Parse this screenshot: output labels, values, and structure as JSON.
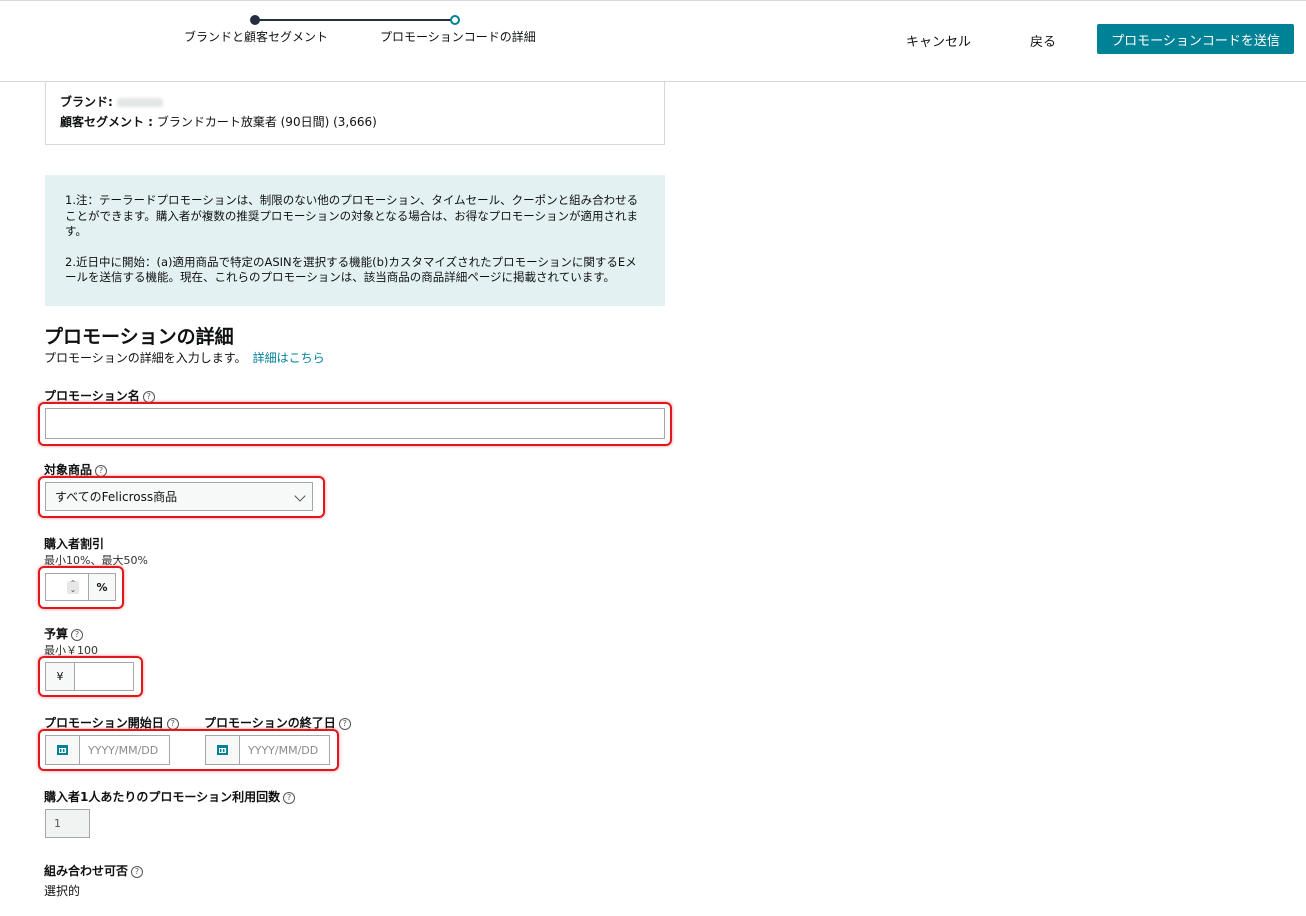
{
  "stepper": {
    "step1": "ブランドと顧客セグメント",
    "step2": "プロモーションコードの詳細"
  },
  "header_actions": {
    "cancel": "キャンセル",
    "back": "戻る",
    "submit": "プロモーションコードを送信"
  },
  "summary": {
    "brand_label": "ブランド:",
    "segment_label": "顧客セグメント :",
    "segment_value": "ブランドカート放棄者 (90日間) (3,666)"
  },
  "notice": {
    "p1": "1.注：テーラードプロモーションは、制限のない他のプロモーション、タイムセール、クーポンと組み合わせることができます。購入者が複数の推奨プロモーションの対象となる場合は、お得なプロモーションが適用されます。",
    "p2": "2.近日中に開始：(a)適用商品で特定のASINを選択する機能(b)カスタマイズされたプロモーションに関するEメールを送信する機能。現在、これらのプロモーションは、該当商品の商品詳細ページに掲載されています。"
  },
  "details": {
    "title": "プロモーションの詳細",
    "subtitle": "プロモーションの詳細を入力します。",
    "link": "詳細はこちら"
  },
  "form": {
    "promo_name_label": "プロモーション名",
    "promo_name_value": "",
    "products_label": "対象商品",
    "products_value": "すべてのFelicross商品",
    "discount_label": "購入者割引",
    "discount_hint": "最小10%、最大50%",
    "discount_unit": "%",
    "budget_label": "予算",
    "budget_hint": "最小￥100",
    "budget_unit": "¥",
    "start_label": "プロモーション開始日",
    "end_label": "プロモーションの終了日",
    "date_placeholder": "YYYY/MM/DD",
    "uses_label": "購入者1人あたりのプロモーション利用回数",
    "uses_value": "1",
    "combine_label": "組み合わせ可否",
    "combine_value": "選択的"
  },
  "help_glyph": "?",
  "colors": {
    "accent": "#008296",
    "highlight": "#e0181b",
    "notice_bg": "#e3f1f2"
  }
}
